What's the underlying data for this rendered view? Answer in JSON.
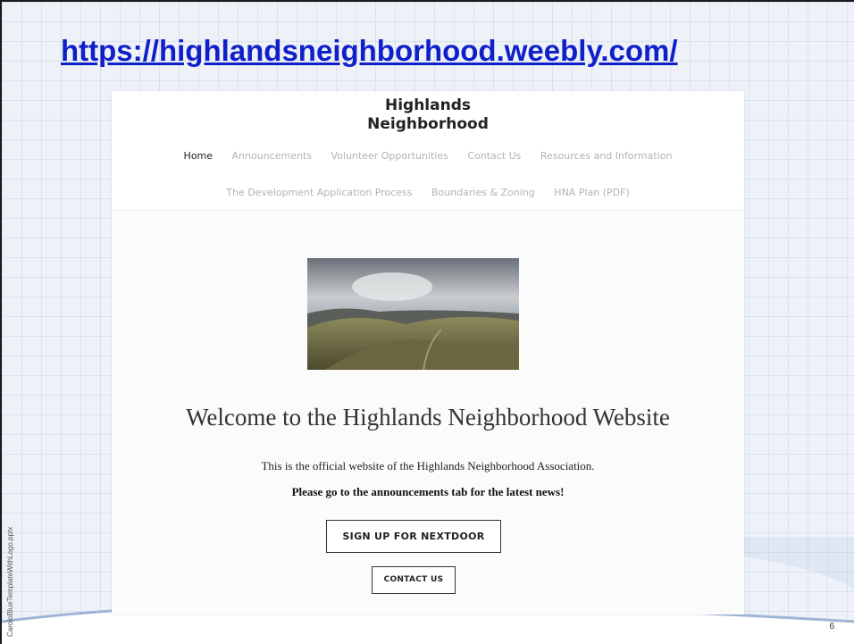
{
  "slide": {
    "title": "https://highlandsneighborhood.weebly.com/",
    "number": "6",
    "template_label": "CaroloBlueTemplateWithLogo.pptx"
  },
  "site": {
    "name_line1": "Highlands",
    "name_line2": "Neighborhood",
    "nav_row1": [
      "Home",
      "Announcements",
      "Volunteer Opportunities",
      "Contact Us",
      "Resources and Information"
    ],
    "nav_row2": [
      "The Development Application Process",
      "Boundaries & Zoning",
      "HNA Plan (PDF)"
    ],
    "active_nav": "Home",
    "welcome_heading": "Welcome to the Highlands Neighborhood Website",
    "intro_text": "This is the official website of the Highlands Neighborhood Association.",
    "cta_note": "Please go to the announcements tab for the latest news!",
    "buttons": {
      "nextdoor": "SIGN UP FOR NEXTDOOR",
      "contact": "CONTACT US"
    }
  },
  "colors": {
    "link_blue": "#1020c8",
    "nav_inactive": "#b3b3b3",
    "nav_active": "#222222"
  }
}
